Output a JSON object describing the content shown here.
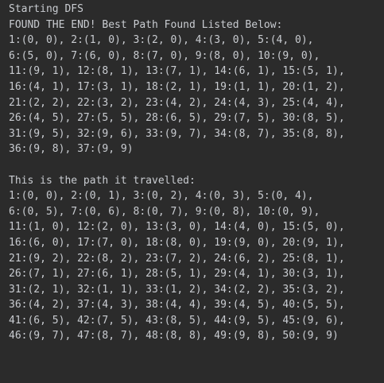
{
  "console": {
    "lines": [
      "Starting DFS",
      "FOUND THE END! Best Path Found Listed Below:",
      "1:(0, 0), 2:(1, 0), 3:(2, 0), 4:(3, 0), 5:(4, 0),",
      "6:(5, 0), 7:(6, 0), 8:(7, 0), 9:(8, 0), 10:(9, 0),",
      "11:(9, 1), 12:(8, 1), 13:(7, 1), 14:(6, 1), 15:(5, 1),",
      "16:(4, 1), 17:(3, 1), 18:(2, 1), 19:(1, 1), 20:(1, 2),",
      "21:(2, 2), 22:(3, 2), 23:(4, 2), 24:(4, 3), 25:(4, 4),",
      "26:(4, 5), 27:(5, 5), 28:(6, 5), 29:(7, 5), 30:(8, 5),",
      "31:(9, 5), 32:(9, 6), 33:(9, 7), 34:(8, 7), 35:(8, 8),",
      "36:(9, 8), 37:(9, 9)",
      "",
      "This is the path it travelled:",
      "1:(0, 0), 2:(0, 1), 3:(0, 2), 4:(0, 3), 5:(0, 4),",
      "6:(0, 5), 7:(0, 6), 8:(0, 7), 9:(0, 8), 10:(0, 9),",
      "11:(1, 0), 12:(2, 0), 13:(3, 0), 14:(4, 0), 15:(5, 0),",
      "16:(6, 0), 17:(7, 0), 18:(8, 0), 19:(9, 0), 20:(9, 1),",
      "21:(9, 2), 22:(8, 2), 23:(7, 2), 24:(6, 2), 25:(8, 1),",
      "26:(7, 1), 27:(6, 1), 28:(5, 1), 29:(4, 1), 30:(3, 1),",
      "31:(2, 1), 32:(1, 1), 33:(1, 2), 34:(2, 2), 35:(3, 2),",
      "36:(4, 2), 37:(4, 3), 38:(4, 4), 39:(4, 5), 40:(5, 5),",
      "41:(6, 5), 42:(7, 5), 43:(8, 5), 44:(9, 5), 45:(9, 6),",
      "46:(9, 7), 47:(8, 7), 48:(8, 8), 49:(9, 8), 50:(9, 9)"
    ]
  },
  "colors": {
    "background": "#2b2b2b",
    "text": "#c9ccd1"
  }
}
